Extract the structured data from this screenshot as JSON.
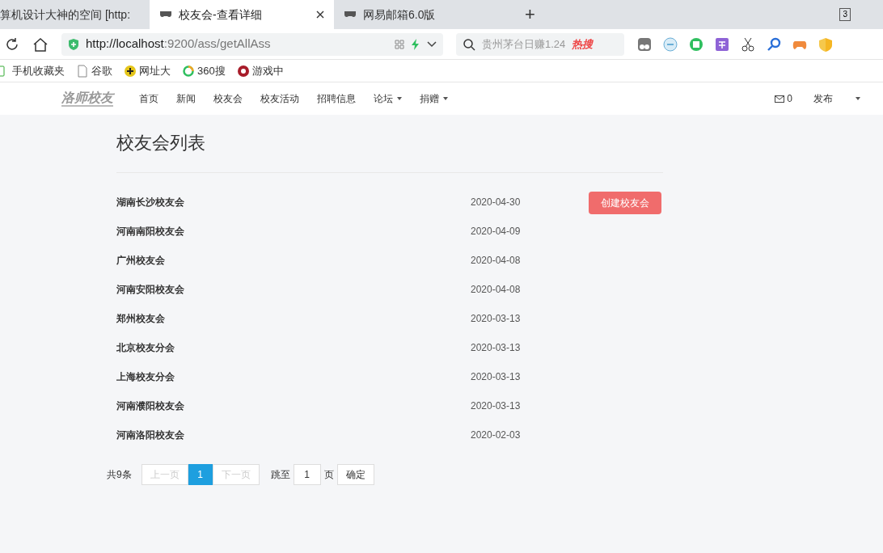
{
  "browser": {
    "tabs": [
      {
        "title": "算机设计大神的空间 [http:",
        "selected": false,
        "closable": false
      },
      {
        "title": "校友会-查看详细",
        "selected": true,
        "closable": true
      },
      {
        "title": "网易邮箱6.0版",
        "selected": false,
        "closable": false
      }
    ],
    "new_tab": "+",
    "tab_count": "3",
    "url_host": "http://localhost",
    "url_rest": ":9200/ass/getAllAss",
    "search_placeholder": "贵州茅台日赚1.24",
    "hot_search": "热搜",
    "bookmarks": [
      "手机收藏夹",
      "谷歌",
      "网址大",
      "360搜",
      "游戏中"
    ]
  },
  "nav": {
    "logo": "洛师校友",
    "items": [
      {
        "label": "首页",
        "dropdown": false
      },
      {
        "label": "新闻",
        "dropdown": false
      },
      {
        "label": "校友会",
        "dropdown": false
      },
      {
        "label": "校友活动",
        "dropdown": false
      },
      {
        "label": "招聘信息",
        "dropdown": false
      },
      {
        "label": "论坛",
        "dropdown": true
      },
      {
        "label": "捐赠",
        "dropdown": true
      }
    ],
    "messages": "0",
    "publish": "发布"
  },
  "page": {
    "title": "校友会列表",
    "create_button": "创建校友会",
    "rows": [
      {
        "name": "湖南长沙校友会",
        "date": "2020-04-30"
      },
      {
        "name": "河南南阳校友会",
        "date": "2020-04-09"
      },
      {
        "name": "广州校友会",
        "date": "2020-04-08"
      },
      {
        "name": "河南安阳校友会",
        "date": "2020-04-08"
      },
      {
        "name": "郑州校友会",
        "date": "2020-03-13"
      },
      {
        "name": "北京校友分会",
        "date": "2020-03-13"
      },
      {
        "name": "上海校友分会",
        "date": "2020-03-13"
      },
      {
        "name": "河南濮阳校友会",
        "date": "2020-03-13"
      },
      {
        "name": "河南洛阳校友会",
        "date": "2020-02-03"
      }
    ],
    "pagination": {
      "total": "共9条",
      "prev": {
        "label": "上一页",
        "disabled": true
      },
      "pages": [
        {
          "label": "1",
          "selected": true
        }
      ],
      "next": {
        "label": "下一页",
        "disabled": true
      },
      "jump_label": "跳至",
      "jump_value": "1",
      "page_unit": "页",
      "confirm": "确定"
    }
  }
}
